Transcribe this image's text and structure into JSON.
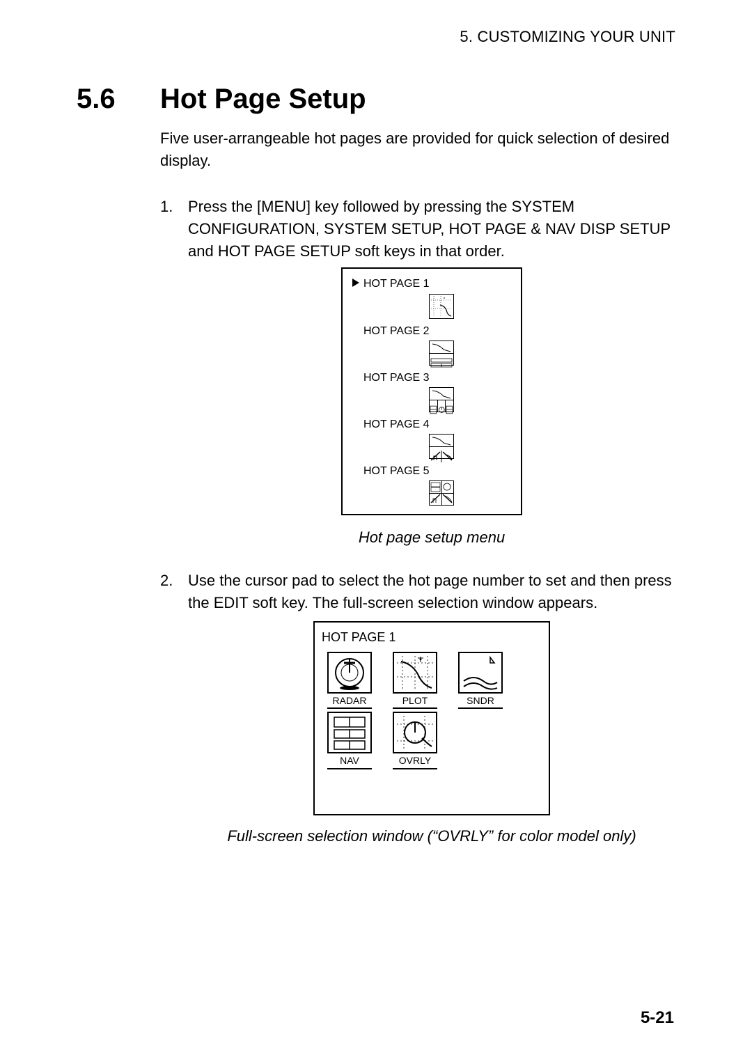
{
  "running_head": "5. CUSTOMIZING YOUR UNIT",
  "section": {
    "number": "5.6",
    "title": "Hot Page Setup"
  },
  "intro": "Five user-arrangeable hot pages are provided for quick selection of desired display.",
  "steps": [
    "Press the [MENU] key followed by pressing the SYSTEM CONFIGURATION, SYSTEM SETUP, HOT PAGE & NAV DISP SETUP and HOT PAGE SETUP soft keys in that order.",
    "Use the cursor pad to select the hot page number to set and then press the EDIT soft key. The full-screen selection window appears."
  ],
  "fig1": {
    "items": [
      {
        "label": "HOT PAGE 1",
        "selected": true
      },
      {
        "label": "HOT PAGE 2",
        "selected": false
      },
      {
        "label": "HOT PAGE 3",
        "selected": false
      },
      {
        "label": "HOT PAGE 4",
        "selected": false
      },
      {
        "label": "HOT PAGE 5",
        "selected": false
      }
    ],
    "caption": "Hot page setup menu"
  },
  "fig2": {
    "title": "HOT PAGE 1",
    "options": [
      {
        "name": "RADAR"
      },
      {
        "name": "PLOT"
      },
      {
        "name": "SNDR"
      },
      {
        "name": "NAV"
      },
      {
        "name": "OVRLY"
      }
    ],
    "caption": "Full-screen selection window (“OVRLY” for color model only)"
  },
  "page_number": "5-21"
}
